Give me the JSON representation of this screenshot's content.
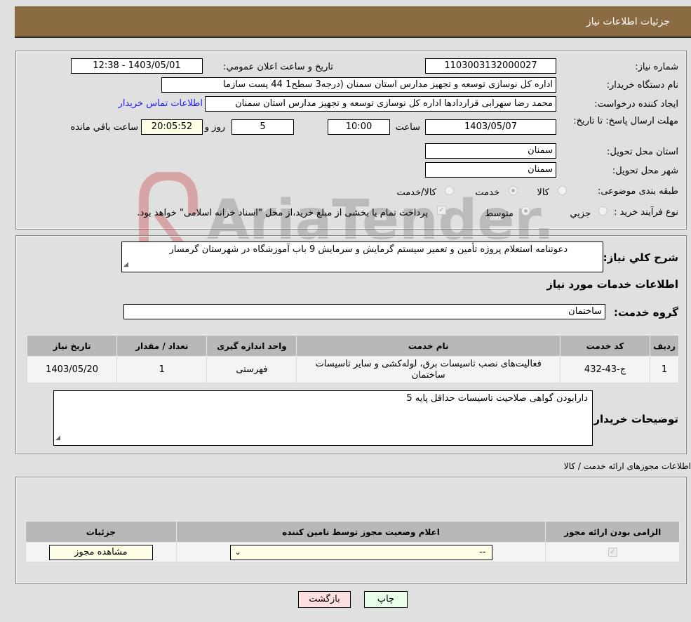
{
  "header": {
    "title": "جزئیات اطلاعات نیاز"
  },
  "form": {
    "need_number": {
      "label": "شماره نیاز:",
      "value": "1103003132000027"
    },
    "announce_datetime": {
      "label": "تاریخ و ساعت اعلان عمومي:",
      "value": "1403/05/01 - 12:38"
    },
    "buyer_org": {
      "label": "نام دستگاه خریدار:",
      "value": "اداره کل نوسازی   توسعه و تجهیز مدارس استان سمنان (درجه3  سطح1  44 پست سازما"
    },
    "requester": {
      "label": "ایجاد کننده درخواست:",
      "value": "محمد رضا سهرابی قراردادها اداره کل نوسازی   توسعه و تجهیز مدارس استان سمنان"
    },
    "contact_link": "اطلاعات تماس خریدار",
    "deadline": {
      "label": "مهلت ارسال پاسخ: تا تاریخ:",
      "date": "1403/05/07",
      "time_label": "ساعت",
      "time": "10:00",
      "days": "5",
      "days_label": "روز و",
      "remaining": "20:05:52",
      "remaining_label": "ساعت باقي مانده"
    },
    "delivery_province": {
      "label": "استان محل تحویل:",
      "value": "سمنان"
    },
    "delivery_city": {
      "label": "شهر محل تحویل:",
      "value": "سمنان"
    },
    "category": {
      "label": "طبقه بندی موضوعی:",
      "options": [
        "کالا",
        "خدمت",
        "کالا/خدمت"
      ],
      "selected": "خدمت"
    },
    "purchase_type": {
      "label": "نوع فرآیند خرید :",
      "options": [
        "جزيي",
        "متوسط"
      ],
      "selected": "متوسط",
      "payment_note": "پرداخت تمام یا بخشی از مبلغ خرید،از محل \"اسناد خزانه اسلامی\" خواهد بود.",
      "payment_checked": true
    }
  },
  "description": {
    "label": "شرح كلي نياز:",
    "value": "دعوتنامه استعلام پروژه تأمین و تعمیر سیستم گرمایش و سرمایش 9 باب آموزشگاه در شهرستان گرمسار"
  },
  "services": {
    "section_title": "اطلاعات خدمات مورد نیاز",
    "group_label": "گروه خدمت:",
    "group_value": "ساختمان",
    "columns": [
      "ردیف",
      "کد خدمت",
      "نام خدمت",
      "واحد اندازه گیری",
      "تعداد / مقدار",
      "تاریخ نیاز"
    ],
    "rows": [
      {
        "row": "1",
        "code": "ج-43-432",
        "name": "فعالیت‌های نصب تاسیسات برق، لوله‌کشی و سایر تاسیسات ساختمان",
        "unit": "فهرستی",
        "qty": "1",
        "date": "1403/05/20"
      }
    ]
  },
  "buyer_notes": {
    "label": "توضیحات خریدار:",
    "value": "دارابودن گواهی صلاحیت تاسیسات  حداقل پایه 5"
  },
  "licenses": {
    "section_title": "اطلاعات مجوزهای ارائه خدمت / کالا",
    "columns": [
      "الزامی بودن ارائه مجوز",
      "اعلام وضعیت مجوز توسط تامین کننده",
      "جزئیات"
    ],
    "rows": [
      {
        "required": true,
        "status": "--",
        "details_button": "مشاهده مجوز"
      }
    ]
  },
  "buttons": {
    "print": "چاپ",
    "back": "بازگشت"
  },
  "watermark": "AriaTender.neT"
}
